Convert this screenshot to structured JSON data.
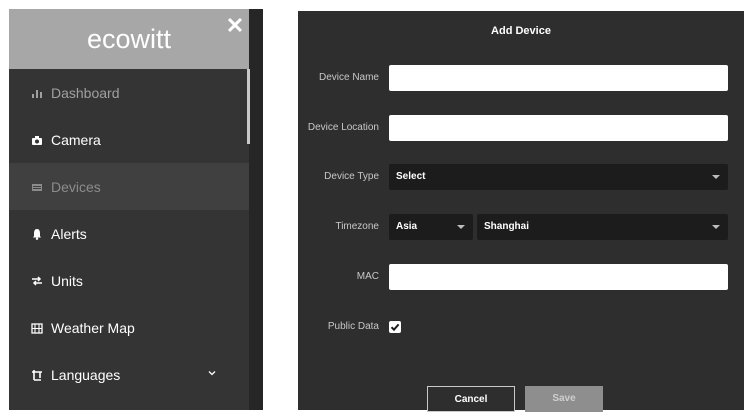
{
  "sidebar": {
    "logo": "ecowitt",
    "close_glyph": "✕",
    "items": [
      {
        "label": "Dashboard",
        "icon": "bar-chart-icon",
        "state": "dim"
      },
      {
        "label": "Camera",
        "icon": "camera-icon",
        "state": "normal"
      },
      {
        "label": "Devices",
        "icon": "devices-icon",
        "state": "active"
      },
      {
        "label": "Alerts",
        "icon": "bell-icon",
        "state": "normal"
      },
      {
        "label": "Units",
        "icon": "exchange-icon",
        "state": "normal"
      },
      {
        "label": "Weather Map",
        "icon": "map-icon",
        "state": "normal"
      },
      {
        "label": "Languages",
        "icon": "translate-icon",
        "state": "normal",
        "has_dropdown": true
      }
    ]
  },
  "dialog": {
    "title": "Add Device",
    "device_name": {
      "label": "Device Name",
      "value": ""
    },
    "device_location": {
      "label": "Device Location",
      "value": ""
    },
    "device_type": {
      "label": "Device Type",
      "selected": "Select"
    },
    "timezone": {
      "label": "Timezone",
      "region": "Asia",
      "city": "Shanghai"
    },
    "mac": {
      "label": "MAC",
      "value": ""
    },
    "public_data": {
      "label": "Public Data",
      "checked": true
    },
    "cancel_label": "Cancel",
    "save_label": "Save"
  },
  "colors": {
    "sidebar_bg": "#343434",
    "sidebar_header": "#a7a7a7",
    "dialog_bg": "#2e2e2e",
    "select_bg": "#1c1c1c",
    "save_disabled": "#8e8e8e"
  }
}
